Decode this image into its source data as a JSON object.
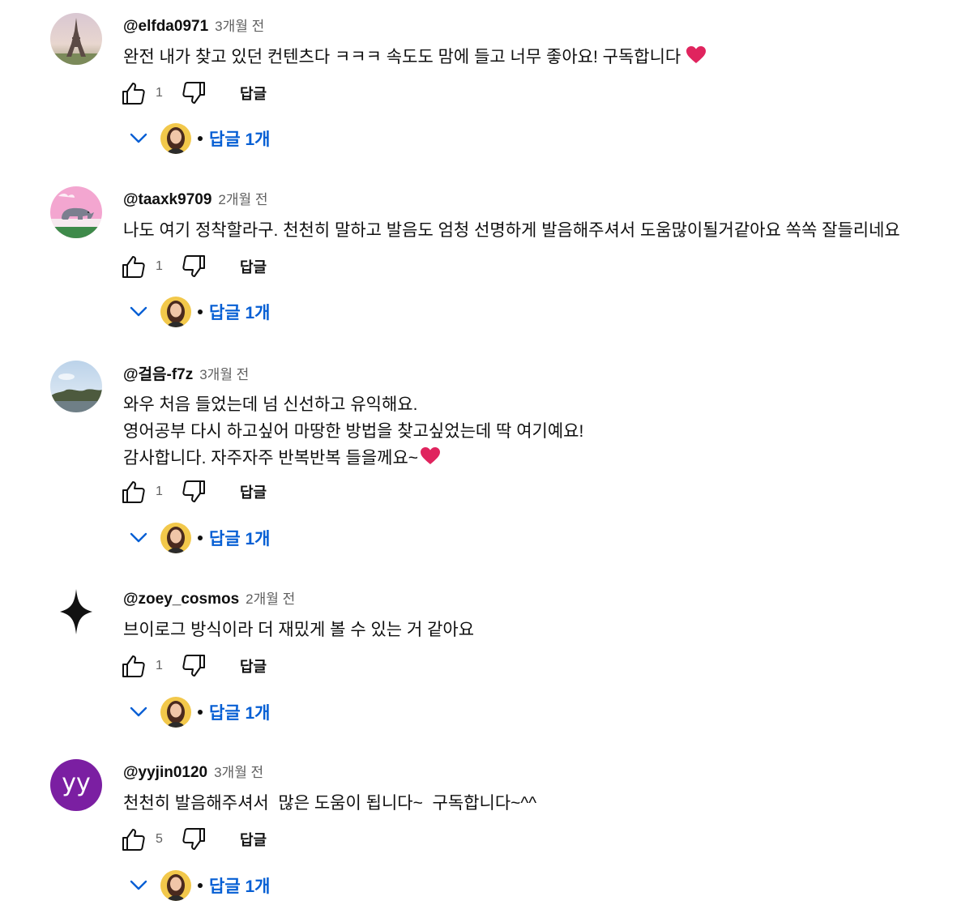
{
  "comments": [
    {
      "author": "@elfda0971",
      "time": "3개월 전",
      "lines": [
        "완전 내가 찾고 있던 컨텐츠다 ㅋㅋㅋ 속도도 맘에 들고 너무 좋아요! 구독합니다"
      ],
      "heart_on_line": 0,
      "likes": "1",
      "reply_label": "답글",
      "replies_label": "답글 1개",
      "avatar_icon": "eiffel-tower-avatar"
    },
    {
      "author": "@taaxk9709",
      "time": "2개월 전",
      "lines": [
        "나도 여기 정착할라구. 천천히 말하고 발음도 엄청 선명하게 발음해주셔서 도움많이될거같아요 쏙쏙 잘들리네요"
      ],
      "heart_on_line": -1,
      "likes": "1",
      "reply_label": "답글",
      "replies_label": "답글 1개",
      "avatar_icon": "rhino-avatar"
    },
    {
      "author": "@걸음-f7z",
      "time": "3개월 전",
      "lines": [
        "와우 처음 들었는데 넘 신선하고 유익해요.",
        "영어공부 다시 하고싶어 마땅한 방법을 찾고싶었는데 딱 여기예요!",
        "감사합니다. 자주자주 반복반복 들을께요~"
      ],
      "heart_on_line": 2,
      "likes": "1",
      "reply_label": "답글",
      "replies_label": "답글 1개",
      "avatar_icon": "landscape-avatar"
    },
    {
      "author": "@zoey_cosmos",
      "time": "2개월 전",
      "lines": [
        "브이로그 방식이라 더 재밌게 볼 수 있는 거 같아요"
      ],
      "heart_on_line": -1,
      "likes": "1",
      "reply_label": "답글",
      "replies_label": "답글 1개",
      "avatar_icon": "sparkle-star-avatar"
    },
    {
      "author": "@yyjin0120",
      "time": "3개월 전",
      "lines": [
        "천천히 발음해주셔서  많은 도움이 됩니다~  구독합니다~^^"
      ],
      "heart_on_line": -1,
      "likes": "5",
      "reply_label": "답글",
      "replies_label": "답글 1개",
      "avatar_icon": "letter-avatar",
      "avatar_letters": "yy",
      "avatar_color": "#7b1fa2"
    }
  ],
  "icons": {
    "like": "thumbs-up-icon",
    "dislike": "thumbs-down-icon",
    "expand": "chevron-down-icon",
    "heart": "red-heart-emoji"
  },
  "colors": {
    "accent_blue": "#065fd4",
    "muted_text": "#606060",
    "heart_red": "#e0245e"
  }
}
